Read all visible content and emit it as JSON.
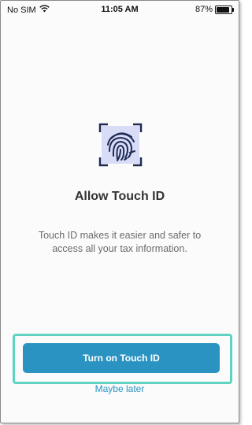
{
  "status_bar": {
    "carrier": "No SIM",
    "time": "11:05 AM",
    "battery": "87%",
    "battery_level": 0.87
  },
  "main": {
    "icon": "fingerprint-icon",
    "title": "Allow Touch ID",
    "description": "Touch ID makes it easier and safer to access all your tax information."
  },
  "actions": {
    "primary_label": "Turn on Touch ID",
    "secondary_label": "Maybe later"
  },
  "colors": {
    "accent": "#2a93c1",
    "highlight": "#5fd3c2",
    "icon_bg": "#d8dcf7",
    "icon_stroke": "#1f2a55"
  }
}
